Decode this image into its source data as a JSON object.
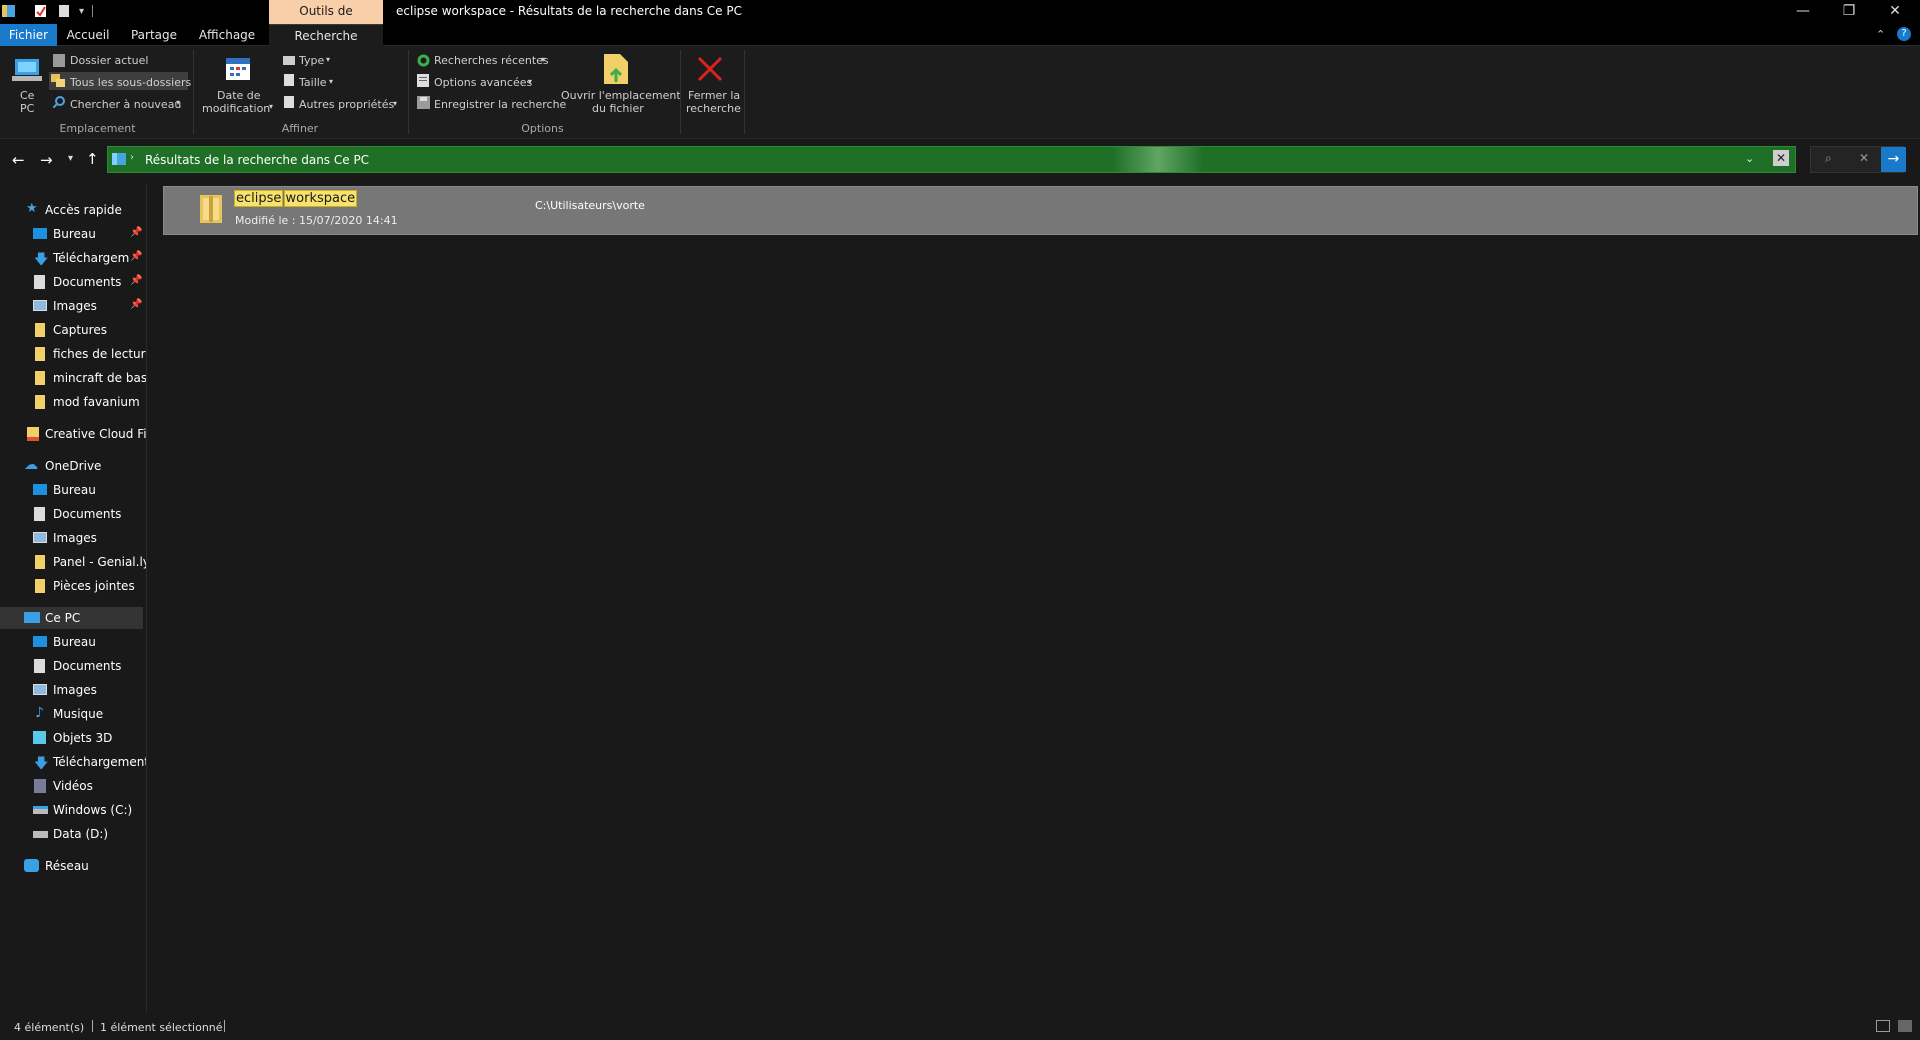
{
  "window": {
    "title": "eclipse workspace - Résultats de la recherche dans Ce PC",
    "context_group": "Outils de recherche"
  },
  "tabs": [
    {
      "label": "Fichier"
    },
    {
      "label": "Accueil"
    },
    {
      "label": "Partage"
    },
    {
      "label": "Affichage"
    },
    {
      "label": "Recherche"
    }
  ],
  "ribbon": {
    "emplacement": {
      "label": "Emplacement",
      "ce_pc_line1": "Ce",
      "ce_pc_line2": "PC",
      "dossier_actuel": "Dossier actuel",
      "tous_sous_dossiers": "Tous les sous-dossiers",
      "chercher_nouveau": "Chercher à nouveau"
    },
    "affiner": {
      "label": "Affiner",
      "date_line1": "Date de",
      "date_line2": "modification",
      "type": "Type",
      "taille": "Taille",
      "autres": "Autres propriétés"
    },
    "options": {
      "label": "Options",
      "recentes": "Recherches récentes",
      "avancees": "Options avancées",
      "enregistrer": "Enregistrer la recherche",
      "ouvrir_line1": "Ouvrir l'emplacement",
      "ouvrir_line2": "du fichier",
      "fermer_line1": "Fermer la",
      "fermer_line2": "recherche"
    }
  },
  "address": {
    "path": "Résultats de la recherche dans Ce PC"
  },
  "sidebar": {
    "quick_access": {
      "label": "Accès rapide",
      "items": [
        "Bureau",
        "Téléchargements",
        "Documents",
        "Images",
        "Captures",
        "fiches de lecture l",
        "mincraft de base",
        "mod favanium"
      ]
    },
    "creative_cloud": "Creative Cloud Files",
    "onedrive": {
      "label": "OneDrive",
      "items": [
        "Bureau",
        "Documents",
        "Images",
        "Panel - Genial.ly b",
        "Pièces jointes"
      ]
    },
    "ce_pc": {
      "label": "Ce PC",
      "items": [
        "Bureau",
        "Documents",
        "Images",
        "Musique",
        "Objets 3D",
        "Téléchargements",
        "Vidéos",
        "Windows (C:)",
        "Data (D:)"
      ]
    },
    "reseau": "Réseau"
  },
  "results": [
    {
      "name_part1": "eclipse",
      "name_part2": "workspace",
      "modified": "Modifié le : 15/07/2020 14:41",
      "location": "C:\\Utilisateurs\\vorte"
    }
  ],
  "status": {
    "count": "4 élément(s)",
    "selected": "1 élément sélectionné"
  },
  "colors": {
    "address_bg": "#1f6f27",
    "accent": "#0078d7",
    "context_tab": "#f8cfa8",
    "highlight": "#f7e36b"
  }
}
